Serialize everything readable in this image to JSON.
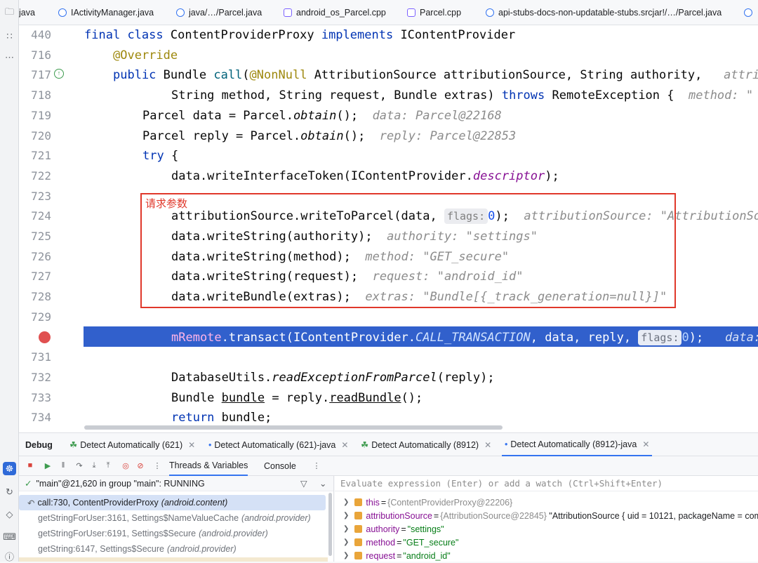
{
  "sidebar": {
    "icons": [
      "folder-icon",
      "structure-icon",
      "more-icon",
      "debug-icon",
      "services-icon",
      "gem-icon",
      "terminal-icon",
      "problems-icon"
    ]
  },
  "tabs": [
    {
      "label": "java",
      "icon": "java-icon"
    },
    {
      "label": "IActivityManager.java",
      "icon": "java-icon"
    },
    {
      "label": "java/…/Parcel.java",
      "icon": "java-icon"
    },
    {
      "label": "android_os_Parcel.cpp",
      "icon": "cpp-icon"
    },
    {
      "label": "Parcel.cpp",
      "icon": "cpp-icon"
    },
    {
      "label": "api-stubs-docs-non-updatable-stubs.srcjar!/…/Parcel.java",
      "icon": "java-icon"
    }
  ],
  "editor": {
    "line_numbers": [
      "440",
      "716",
      "717",
      "718",
      "719",
      "720",
      "721",
      "722",
      "723",
      "724",
      "725",
      "726",
      "727",
      "728",
      "729",
      "",
      "731",
      "732",
      "733",
      "734"
    ],
    "annotation": "请求参数",
    "code": {
      "l440": {
        "k1": "final",
        "k2": "class",
        "name": "ContentProviderProxy",
        "k3": "implements",
        "iface": "IContentProvider"
      },
      "l716": "@Override",
      "l717": {
        "k": "public",
        "ret": "Bundle",
        "fn": "call",
        "an": "@NonNull",
        "rest": "AttributionSource attributionSource, String authority,",
        "hint": "attri"
      },
      "l718": {
        "text": "String method, String request, Bundle extras)",
        "throws": "throws",
        "rest": "RemoteException {",
        "hint": "method: \""
      },
      "l719": {
        "pre": "Parcel data = Parcel.",
        "fn": "obtain",
        "post": "();",
        "hint": "data: Parcel@22168"
      },
      "l720": {
        "pre": "Parcel reply = Parcel.",
        "fn": "obtain",
        "post": "();",
        "hint": "reply: Parcel@22853"
      },
      "l721": {
        "k": "try",
        "post": " {"
      },
      "l722": {
        "pre": "data.writeInterfaceToken(IContentProvider.",
        "field": "descriptor",
        "post": ");"
      },
      "l724": {
        "pre": "attributionSource.writeToParcel(data, ",
        "inlay": "flags:",
        "num": "0",
        "post": ");",
        "hint": "attributionSource: \"AttributionSo"
      },
      "l725": {
        "pre": "data.writeString(authority);",
        "hint": "authority: \"settings\""
      },
      "l726": {
        "pre": "data.writeString(method);",
        "hint": "method: \"GET_secure\""
      },
      "l727": {
        "pre": "data.writeString(request);",
        "hint": "request: \"android_id\""
      },
      "l728": {
        "pre": "data.writeBundle(extras);",
        "hint": "extras: \"Bundle[{_track_generation=null}]\""
      },
      "l730": {
        "field": "mRemote",
        "pre": ".transact(IContentProvider.",
        "const": "CALL_TRANSACTION",
        "mid": ", data, reply, ",
        "inlay": "flags:",
        "num": "0",
        "post": ");",
        "hint": "data:"
      },
      "l732": {
        "pre": "DatabaseUtils.",
        "fn": "readExceptionFromParcel",
        "post": "(reply);"
      },
      "l733": {
        "pre": "Bundle ",
        "var": "bundle",
        "mid": " = reply.",
        "fn": "readBundle",
        "post": "();"
      },
      "l734": {
        "k": "return",
        "post": " bundle;"
      }
    }
  },
  "debug": {
    "label": "Debug",
    "sessions": [
      {
        "label": "Detect Automatically (621)"
      },
      {
        "label": "Detect Automatically (621)-java"
      },
      {
        "label": "Detect Automatically (8912)"
      },
      {
        "label": "Detect Automatically (8912)-java"
      }
    ],
    "subtabs": [
      "Threads & Variables",
      "Console"
    ],
    "thread": "\"main\"@21,620 in group \"main\": RUNNING",
    "frames": [
      {
        "method": "call:730, ContentProviderProxy",
        "pkg": "(android.content)"
      },
      {
        "method": "getStringForUser:3161, Settings$NameValueCache",
        "pkg": "(android.provider)"
      },
      {
        "method": "getStringForUser:6191, Settings$Secure",
        "pkg": "(android.provider)"
      },
      {
        "method": "getString:6147, Settings$Secure",
        "pkg": "(android.provider)"
      }
    ],
    "eval_placeholder": "Evaluate expression (Enter) or add a watch (Ctrl+Shift+Enter)",
    "variables": [
      {
        "name": "this",
        "ref": "{ContentProviderProxy@22206}",
        "value": ""
      },
      {
        "name": "attributionSource",
        "ref": "{AttributionSource@22845}",
        "value": "\"AttributionSource { uid = 10121, packageName = com."
      },
      {
        "name": "authority",
        "ref": "",
        "value": "\"settings\""
      },
      {
        "name": "method",
        "ref": "",
        "value": "\"GET_secure\""
      },
      {
        "name": "request",
        "ref": "",
        "value": "\"android_id\""
      }
    ]
  }
}
